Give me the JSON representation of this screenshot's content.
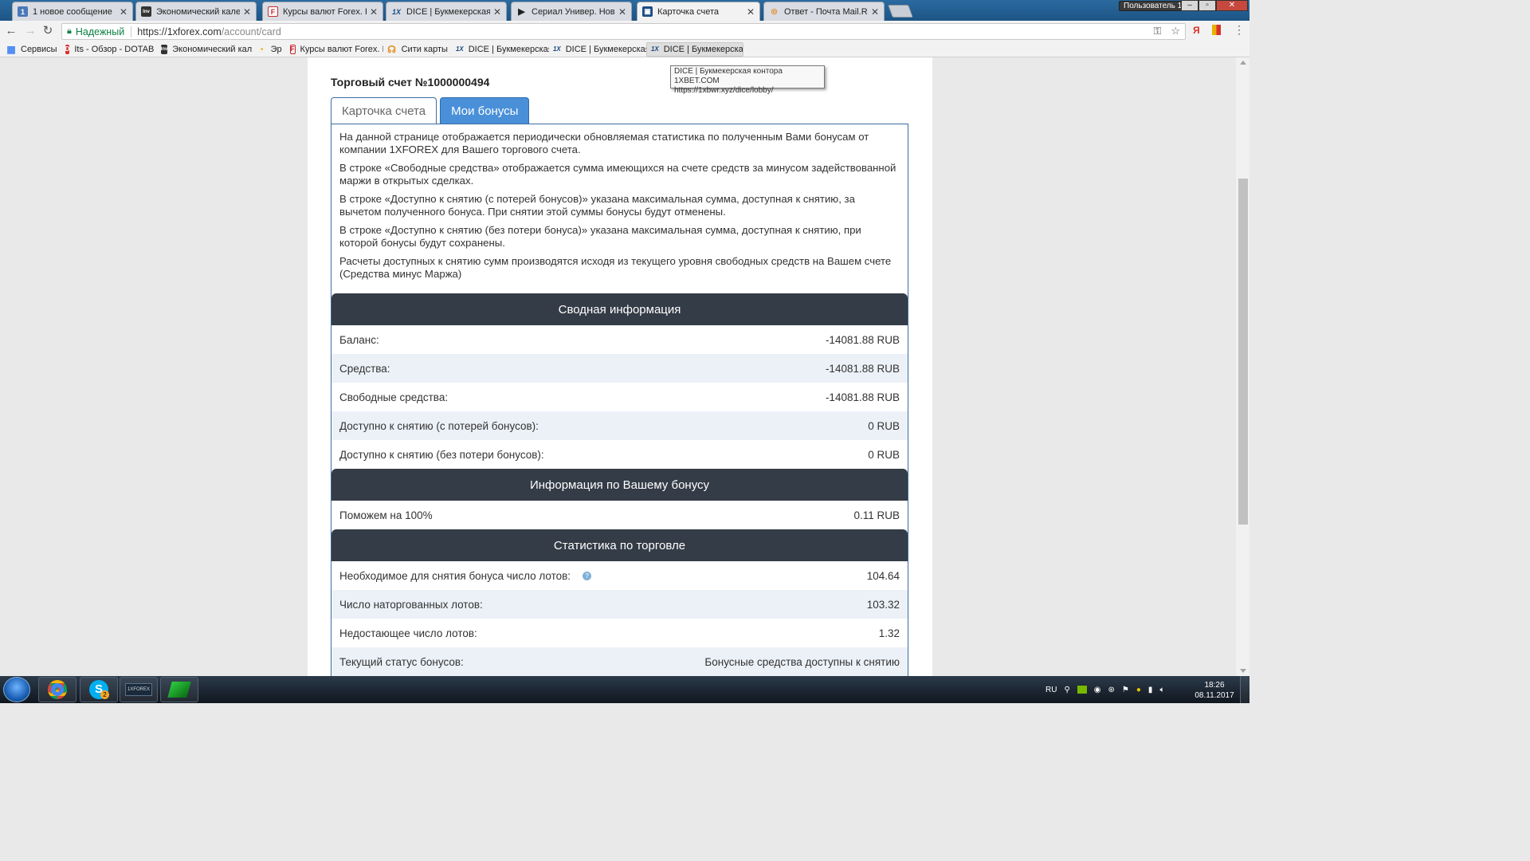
{
  "browser": {
    "tabs": [
      {
        "title": "1 новое сообщение",
        "fav": "1",
        "favColor": "#4a78b8"
      },
      {
        "title": "Экономический календ",
        "fav": "Inv",
        "favColor": "#333"
      },
      {
        "title": "Курсы валют Forex. Кот",
        "fav": "F",
        "favColor": "#c8282d"
      },
      {
        "title": "DICE | Букмекерская кон",
        "fav": "1X",
        "favColor": "#1a4b84"
      },
      {
        "title": "Сериал Универ. Новая о",
        "fav": "▶",
        "favColor": "#222"
      },
      {
        "title": "Карточка счета",
        "fav": "▣",
        "favColor": "#1a4b84"
      },
      {
        "title": "Ответ - Почта Mail.Ru",
        "fav": "◎",
        "favColor": "#e38a1b"
      }
    ],
    "window_user": "Пользователь 1",
    "secure_label": "Надежный",
    "url_host": "https://1xforex.com",
    "url_path": "/account/card",
    "bookmarks": [
      {
        "label": "Сервисы",
        "fav": "▦",
        "favColor": "#4285f4"
      },
      {
        "label": "Its - Обзор - DOTAB",
        "fav": "D",
        "favColor": "#d9302c"
      },
      {
        "label": "Экономический кал",
        "fav": "Inv",
        "favColor": "#333"
      },
      {
        "label": "Эр",
        "fav": "◔",
        "favColor": "#e8b000"
      },
      {
        "label": "Курсы валют Forex. I",
        "fav": "F",
        "favColor": "#c8282d"
      },
      {
        "label": "Сити карты",
        "fav": "☊",
        "favColor": "#e38a1b"
      },
      {
        "label": "DICE | Букмекерская",
        "fav": "1X",
        "favColor": "#1a4b84"
      },
      {
        "label": "DICE | Букмекерская",
        "fav": "1X",
        "favColor": "#1a4b84"
      },
      {
        "label": "DICE | Букмекерская",
        "fav": "1X",
        "favColor": "#1a4b84"
      }
    ],
    "tooltip": {
      "line1": "DICE | Букмекерская контора 1XBET.COM",
      "line2": "https://1xbwr.xyz/dice/lobby/"
    }
  },
  "page": {
    "account_title": "Торговый счет №1000000494",
    "tabs": [
      "Карточка счета",
      "Мои бонусы"
    ],
    "active_tab": 1,
    "intro": [
      "На данной странице отображается периодически обновляемая статистика по полученным Вами бонусам от компании 1XFOREX для Вашего торгового счета.",
      "В строке «Свободные средства» отображается сумма имеющихся на счете средств за минусом задействованной маржи в открытых сделках.",
      "В строке «Доступно к снятию (с потерей бонусов)» указана максимальная сумма, доступная к снятию, за вычетом полученного бонуса. При снятии этой суммы бонусы будут отменены.",
      "В строке «Доступно к снятию (без потери бонуса)» указана максимальная сумма, доступная к снятию, при которой бонусы будут сохранены.",
      "Расчеты доступных к снятию сумм производятся исходя из текущего уровня свободных средств на Вашем счете (Средства минус Маржа)"
    ],
    "summary": {
      "heading": "Сводная информация",
      "rows": [
        {
          "label": "Баланс:",
          "value": "-14081.88 RUB"
        },
        {
          "label": "Средства:",
          "value": "-14081.88 RUB"
        },
        {
          "label": "Свободные средства:",
          "value": "-14081.88 RUB"
        },
        {
          "label": "Доступно к снятию (с потерей бонусов):",
          "value": "0 RUB"
        },
        {
          "label": "Доступно к снятию (без потери бонусов):",
          "value": "0 RUB"
        }
      ]
    },
    "bonus": {
      "heading": "Информация по Вашему бонусу",
      "rows": [
        {
          "label": "Поможем на 100%",
          "value": "0.11 RUB"
        }
      ]
    },
    "trading": {
      "heading": "Статистика по торговле",
      "rows": [
        {
          "label": "Необходимое для снятия бонуса число лотов:",
          "value": "104.64",
          "help": "?"
        },
        {
          "label": "Число наторгованных лотов:",
          "value": "103.32"
        },
        {
          "label": "Недостающее число лотов:",
          "value": "1.32"
        },
        {
          "label": "Текущий статус бонусов:",
          "value": "Бонусные средства доступны к снятию"
        }
      ]
    }
  },
  "taskbar": {
    "lang": "RU",
    "time": "18:26",
    "date": "08.11.2017",
    "skype_badge": "2",
    "forex_label": "1XFOREX"
  }
}
